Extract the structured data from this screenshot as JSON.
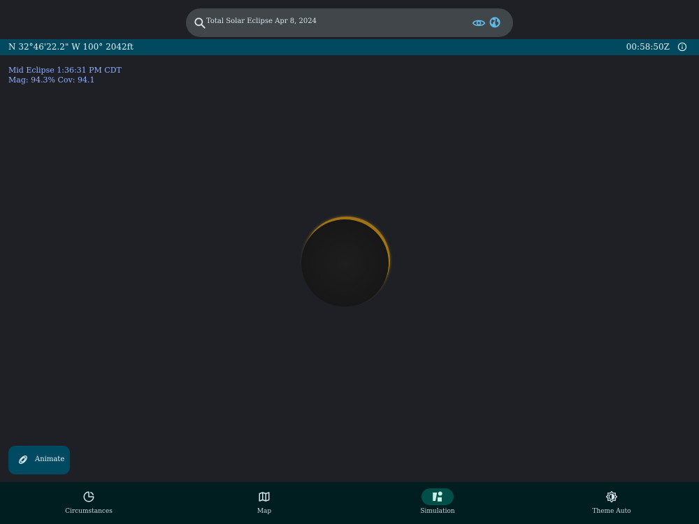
{
  "search": {
    "text": "Total Solar Eclipse Apr 8, 2024",
    "search_icon": "search-icon",
    "eye_icon": "eye-icon",
    "globe_icon": "globe-icon"
  },
  "location_bar": {
    "coords": "N 32°46'22.2\" W 100° 2042ft",
    "time": "00:58:50Z",
    "info_icon": "info-icon"
  },
  "eclipse_info": {
    "line1": "Mid Eclipse 1:36:31 PM CDT",
    "line2": "Mag: 94.3% Cov: 94.1"
  },
  "fab": {
    "label": "Animate",
    "icon": "animate-rings-icon"
  },
  "nav": {
    "items": [
      {
        "label": "Circumstances",
        "icon": "circumstances-icon",
        "active": false
      },
      {
        "label": "Map",
        "icon": "map-icon",
        "active": false
      },
      {
        "label": "Simulation",
        "icon": "simulation-icon",
        "active": true
      },
      {
        "label": "Theme Auto",
        "icon": "theme-auto-icon",
        "active": false
      }
    ]
  },
  "colors": {
    "background": "#1e2026",
    "search_bg": "#40464a",
    "location_bar": "#00495f",
    "info_text": "#8fb0ff",
    "sun_crescent": "#a07414",
    "nav_bg": "#001d20",
    "nav_active_pill": "#005049",
    "accent_icon": "#5fb8e6"
  }
}
